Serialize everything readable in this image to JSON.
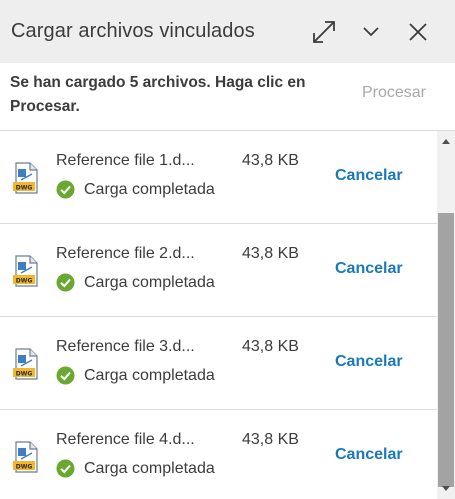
{
  "header": {
    "title": "Cargar archivos vinculados",
    "expand_icon": "expand-icon",
    "collapse_icon": "chevron-down-icon",
    "close_icon": "close-icon"
  },
  "notice": {
    "message": "Se han cargado 5 archivos. Haga clic en Procesar.",
    "process_label": "Procesar"
  },
  "files": [
    {
      "name": "Reference file 1.d...",
      "size": "43,8 KB",
      "status": "Carga completada",
      "cancel_label": "Cancelar"
    },
    {
      "name": "Reference file 2.d...",
      "size": "43,8 KB",
      "status": "Carga completada",
      "cancel_label": "Cancelar"
    },
    {
      "name": "Reference file 3.d...",
      "size": "43,8 KB",
      "status": "Carga completada",
      "cancel_label": "Cancelar"
    },
    {
      "name": "Reference file 4.d...",
      "size": "43,8 KB",
      "status": "Carga completada",
      "cancel_label": "Cancelar"
    }
  ],
  "file_icon_label": "DWG",
  "colors": {
    "accent": "#1a7ab8",
    "success": "#6aa832",
    "header_bg": "#eeeeee",
    "disabled": "#a8a8a8"
  }
}
